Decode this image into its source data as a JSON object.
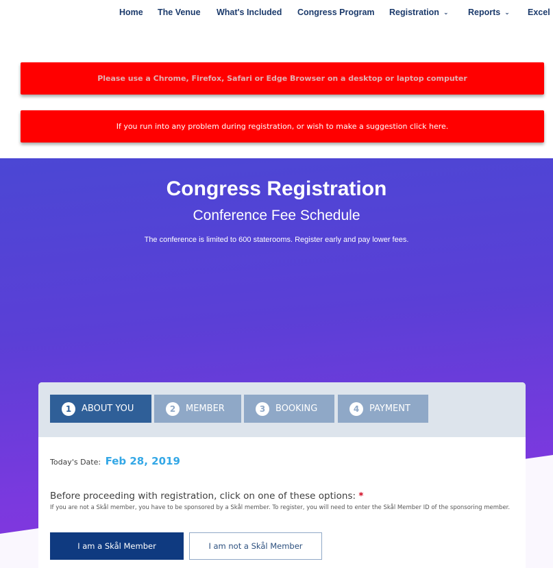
{
  "nav": {
    "items": [
      {
        "label": "Home",
        "has_dropdown": false
      },
      {
        "label": "The Venue",
        "has_dropdown": false
      },
      {
        "label": "What's Included",
        "has_dropdown": false
      },
      {
        "label": "Congress Program",
        "has_dropdown": false
      },
      {
        "label": "Registration",
        "has_dropdown": true
      },
      {
        "label": "Reports",
        "has_dropdown": true
      },
      {
        "label": "Excel",
        "has_dropdown": false
      }
    ],
    "chevron": "⌄"
  },
  "alerts": [
    {
      "text": "Please use a Chrome, Firefox, Safari or Edge Browser on a desktop or laptop computer"
    },
    {
      "text": "If you run into any problem during registration, or wish to make a suggestion click here."
    }
  ],
  "hero": {
    "title": "Congress Registration",
    "subtitle": "Conference Fee Schedule",
    "note": "The conference is limited to 600 staterooms. Register early and pay lower fees."
  },
  "steps": [
    {
      "num": "1",
      "label": "ABOUT YOU",
      "active": true
    },
    {
      "num": "2",
      "label": "MEMBER",
      "active": false
    },
    {
      "num": "3",
      "label": "BOOKING",
      "active": false
    },
    {
      "num": "4",
      "label": "PAYMENT",
      "active": false
    }
  ],
  "form": {
    "date_label": "Today's Date:",
    "date_value": "Feb 28, 2019",
    "prompt": "Before proceeding with registration, click on one of these options:",
    "required_mark": "*",
    "help": "If you are not a Skål member, you have to be sponsored by a Skål member. To register, you will need to enter the Skål Member ID of the sponsoring member.",
    "option_member": "I am a Skål Member",
    "option_non_member": "I am not a Skål Member"
  },
  "colors": {
    "nav_text": "#1b3a6b",
    "alert_bg": "#ff0000",
    "hero_top": "#4b47d4",
    "hero_bottom": "#8c36e0",
    "step_active": "#2f5f98",
    "step_inactive": "#8fa8c7",
    "date_accent": "#33a7e6",
    "primary_button": "#0f3a80"
  }
}
